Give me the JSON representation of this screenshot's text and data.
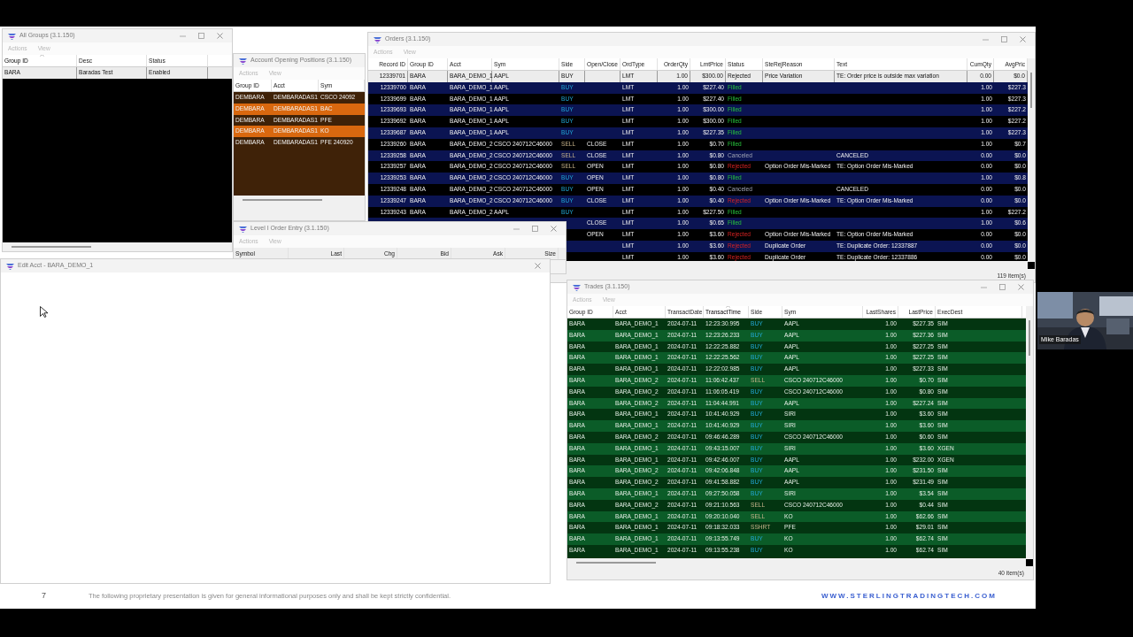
{
  "all_groups": {
    "title": "All Groups (3.1.150)",
    "menu": [
      "Actions",
      "View"
    ],
    "columns": [
      {
        "label": "Group ID",
        "sorted": true
      },
      {
        "label": "Desc",
        "sorted": false
      },
      {
        "label": "Status",
        "sorted": false
      }
    ],
    "rows": [
      {
        "cells": [
          "BARA",
          "Baradas Test",
          "Enabled"
        ],
        "selected": true
      }
    ]
  },
  "account_opening_positions": {
    "title": "Account Opening Positions (3.1.150)",
    "menu": [
      "Actions",
      "View"
    ],
    "columns": [
      {
        "label": "Group ID",
        "sorted": false
      },
      {
        "label": "Acct",
        "sorted": false
      },
      {
        "label": "Sym",
        "sorted": false
      }
    ],
    "rows": [
      {
        "cells": [
          "DEMBARA",
          "DEMBARADAS1",
          "CSCO 24092"
        ],
        "highlighted": false
      },
      {
        "cells": [
          "DEMBARA",
          "DEMBARADAS1",
          "BAC"
        ],
        "highlighted": true
      },
      {
        "cells": [
          "DEMBARA",
          "DEMBARADAS1",
          "PFE"
        ],
        "highlighted": false
      },
      {
        "cells": [
          "DEMBARA",
          "DEMBARADAS1",
          "KO"
        ],
        "highlighted": true
      },
      {
        "cells": [
          "DEMBARA",
          "DEMBARADAS1",
          "PFE 240920"
        ],
        "highlighted": false
      }
    ]
  },
  "orders": {
    "title": "Orders (3.1.150)",
    "menu": [
      "Actions",
      "View"
    ],
    "columns": [
      {
        "label": "Record ID",
        "sorted": false
      },
      {
        "label": "Group ID",
        "sorted": false
      },
      {
        "label": "Acct",
        "sorted": false
      },
      {
        "label": "Sym",
        "sorted": false
      },
      {
        "label": "Side",
        "sorted": false
      },
      {
        "label": "Open/Close",
        "sorted": false
      },
      {
        "label": "OrdType",
        "sorted": false
      },
      {
        "label": "OrderQty",
        "sorted": false
      },
      {
        "label": "LmtPrice",
        "sorted": false
      },
      {
        "label": "Status",
        "sorted": false
      },
      {
        "label": "SteRejReason",
        "sorted": false
      },
      {
        "label": "Text",
        "sorted": false
      },
      {
        "label": "CumQty",
        "sorted": false
      },
      {
        "label": "AvgPric",
        "sorted": false
      }
    ],
    "rows": [
      {
        "cells": [
          "12339701",
          "BARA",
          "BARA_DEMO_1",
          "AAPL",
          {
            "text": "BUY",
            "kind": "buy"
          },
          null,
          "LMT",
          "1.00",
          "$300.00",
          {
            "text": "Rejected",
            "kind": "rejected"
          },
          "Price Variation",
          "TE: Order price is outside max variation",
          "0.00",
          "$0.0"
        ],
        "selected": true
      },
      {
        "cells": [
          "12339700",
          "BARA",
          "BARA_DEMO_1",
          "AAPL",
          {
            "text": "BUY",
            "kind": "buy"
          },
          null,
          "LMT",
          "1.00",
          "$227.40",
          {
            "text": "Filled",
            "kind": "filled"
          },
          null,
          null,
          "1.00",
          "$227.3"
        ],
        "selected": false
      },
      {
        "cells": [
          "12339699",
          "BARA",
          "BARA_DEMO_1",
          "AAPL",
          {
            "text": "BUY",
            "kind": "buy"
          },
          null,
          "LMT",
          "1.00",
          "$227.40",
          {
            "text": "Filled",
            "kind": "filled"
          },
          null,
          null,
          "1.00",
          "$227.3"
        ],
        "selected": false
      },
      {
        "cells": [
          "12339693",
          "BARA",
          "BARA_DEMO_1",
          "AAPL",
          {
            "text": "BUY",
            "kind": "buy"
          },
          null,
          "LMT",
          "1.00",
          "$300.00",
          {
            "text": "Filled",
            "kind": "filled"
          },
          null,
          null,
          "1.00",
          "$227.2"
        ],
        "selected": false
      },
      {
        "cells": [
          "12339692",
          "BARA",
          "BARA_DEMO_1",
          "AAPL",
          {
            "text": "BUY",
            "kind": "buy"
          },
          null,
          "LMT",
          "1.00",
          "$300.00",
          {
            "text": "Filled",
            "kind": "filled"
          },
          null,
          null,
          "1.00",
          "$227.2"
        ],
        "selected": false
      },
      {
        "cells": [
          "12339687",
          "BARA",
          "BARA_DEMO_1",
          "AAPL",
          {
            "text": "BUY",
            "kind": "buy"
          },
          null,
          "LMT",
          "1.00",
          "$227.35",
          {
            "text": "Filled",
            "kind": "filled"
          },
          null,
          null,
          "1.00",
          "$227.3"
        ],
        "selected": false
      },
      {
        "cells": [
          "12339260",
          "BARA",
          "BARA_DEMO_2",
          "CSCO 240712C46000",
          {
            "text": "SELL",
            "kind": "sell"
          },
          "CLOSE",
          "LMT",
          "1.00",
          "$0.70",
          {
            "text": "Filled",
            "kind": "filled"
          },
          null,
          null,
          "1.00",
          "$0.7"
        ],
        "selected": false
      },
      {
        "cells": [
          "12339258",
          "BARA",
          "BARA_DEMO_2",
          "CSCO 240712C46000",
          {
            "text": "SELL",
            "kind": "sell"
          },
          "CLOSE",
          "LMT",
          "1.00",
          "$0.80",
          {
            "text": "Canceled",
            "kind": "canceled"
          },
          null,
          "CANCELED",
          "0.00",
          "$0.0"
        ],
        "selected": false
      },
      {
        "cells": [
          "12339257",
          "BARA",
          "BARA_DEMO_2",
          "CSCO 240712C46000",
          {
            "text": "SELL",
            "kind": "sell"
          },
          "OPEN",
          "LMT",
          "1.00",
          "$0.80",
          {
            "text": "Rejected",
            "kind": "rejected"
          },
          "Option Order Mis-Marked",
          "TE: Option Order Mis-Marked",
          "0.00",
          "$0.0"
        ],
        "selected": false
      },
      {
        "cells": [
          "12339253",
          "BARA",
          "BARA_DEMO_2",
          "CSCO 240712C46000",
          {
            "text": "BUY",
            "kind": "buy"
          },
          "OPEN",
          "LMT",
          "1.00",
          "$0.80",
          {
            "text": "Filled",
            "kind": "filled"
          },
          null,
          null,
          "1.00",
          "$0.8"
        ],
        "selected": false
      },
      {
        "cells": [
          "12339248",
          "BARA",
          "BARA_DEMO_2",
          "CSCO 240712C46000",
          {
            "text": "BUY",
            "kind": "buy"
          },
          "OPEN",
          "LMT",
          "1.00",
          "$0.40",
          {
            "text": "Canceled",
            "kind": "canceled"
          },
          null,
          "CANCELED",
          "0.00",
          "$0.0"
        ],
        "selected": false
      },
      {
        "cells": [
          "12339247",
          "BARA",
          "BARA_DEMO_2",
          "CSCO 240712C46000",
          {
            "text": "BUY",
            "kind": "buy"
          },
          "CLOSE",
          "LMT",
          "1.00",
          "$0.40",
          {
            "text": "Rejected",
            "kind": "rejected"
          },
          "Option Order Mis-Marked",
          "TE: Option Order Mis-Marked",
          "0.00",
          "$0.0"
        ],
        "selected": false
      },
      {
        "cells": [
          "12339243",
          "BARA",
          "BARA_DEMO_2",
          "AAPL",
          {
            "text": "BUY",
            "kind": "buy"
          },
          null,
          "LMT",
          "1.00",
          "$227.50",
          {
            "text": "Filled",
            "kind": "filled"
          },
          null,
          null,
          "1.00",
          "$227.2"
        ],
        "selected": false
      },
      {
        "cells": [
          null,
          null,
          null,
          null,
          null,
          "CLOSE",
          "LMT",
          "1.00",
          "$0.65",
          {
            "text": "Filled",
            "kind": "filled"
          },
          null,
          null,
          "1.00",
          "$0.6"
        ],
        "selected": false
      },
      {
        "cells": [
          null,
          null,
          null,
          null,
          null,
          "OPEN",
          "LMT",
          "1.00",
          "$3.60",
          {
            "text": "Rejected",
            "kind": "rejected"
          },
          "Option Order Mis-Marked",
          "TE: Option Order Mis-Marked",
          "0.00",
          "$0.0"
        ],
        "selected": false
      },
      {
        "cells": [
          null,
          null,
          null,
          null,
          null,
          null,
          "LMT",
          "1.00",
          "$3.60",
          {
            "text": "Rejected",
            "kind": "rejected"
          },
          "Duplicate Order",
          "TE: Duplicate Order: 12337887",
          "0.00",
          "$0.0"
        ],
        "selected": false
      },
      {
        "cells": [
          null,
          null,
          null,
          null,
          null,
          null,
          "LMT",
          "1.00",
          "$3.60",
          {
            "text": "Rejected",
            "kind": "rejected"
          },
          "Duplicate Order",
          "TE: Duplicate Order: 12337886",
          "0.00",
          "$0.0"
        ],
        "selected": false
      }
    ],
    "status_text": "119 item(s)"
  },
  "level_1_order_entry": {
    "title": "Level I Order Entry (3.1.150)",
    "menu": [
      "Actions",
      "View"
    ],
    "columns": [
      {
        "label": "Symbol",
        "sorted": false
      },
      {
        "label": "Last",
        "sorted": false
      },
      {
        "label": "Chg",
        "sorted": false
      },
      {
        "label": "Bid",
        "sorted": false
      },
      {
        "label": "Ask",
        "sorted": false
      },
      {
        "label": "Size",
        "sorted": false
      }
    ]
  },
  "edit_acct": {
    "title": "Edit Acct - BARA_DEMO_1"
  },
  "trades": {
    "title": "Trades (3.1.150)",
    "menu": [
      "Actions",
      "View"
    ],
    "columns": [
      {
        "label": "Group ID",
        "sorted": false
      },
      {
        "label": "Acct",
        "sorted": false
      },
      {
        "label": "TransactDate",
        "sorted": false
      },
      {
        "label": "TransactTime",
        "sorted": true
      },
      {
        "label": "Side",
        "sorted": false
      },
      {
        "label": "Sym",
        "sorted": false
      },
      {
        "label": "LastShares",
        "sorted": false
      },
      {
        "label": "LastPrice",
        "sorted": false
      },
      {
        "label": "ExecDest",
        "sorted": false
      }
    ],
    "rows": [
      {
        "cells": [
          "BARA",
          "BARA_DEMO_1",
          "2024-07-11",
          "12:23:30.995",
          {
            "text": "BUY",
            "kind": "buy"
          },
          "AAPL",
          "1.00",
          "$227.35",
          "SIM"
        ],
        "selected": false
      },
      {
        "cells": [
          "BARA",
          "BARA_DEMO_1",
          "2024-07-11",
          "12:23:26.233",
          {
            "text": "BUY",
            "kind": "buy"
          },
          "AAPL",
          "1.00",
          "$227.36",
          "SIM"
        ],
        "selected": false
      },
      {
        "cells": [
          "BARA",
          "BARA_DEMO_1",
          "2024-07-11",
          "12:22:25.882",
          {
            "text": "BUY",
            "kind": "buy"
          },
          "AAPL",
          "1.00",
          "$227.25",
          "SIM"
        ],
        "selected": false
      },
      {
        "cells": [
          "BARA",
          "BARA_DEMO_1",
          "2024-07-11",
          "12:22:25.562",
          {
            "text": "BUY",
            "kind": "buy"
          },
          "AAPL",
          "1.00",
          "$227.25",
          "SIM"
        ],
        "selected": false
      },
      {
        "cells": [
          "BARA",
          "BARA_DEMO_1",
          "2024-07-11",
          "12:22:02.985",
          {
            "text": "BUY",
            "kind": "buy"
          },
          "AAPL",
          "1.00",
          "$227.33",
          "SIM"
        ],
        "selected": false
      },
      {
        "cells": [
          "BARA",
          "BARA_DEMO_2",
          "2024-07-11",
          "11:06:42.437",
          {
            "text": "SELL",
            "kind": "sell"
          },
          "CSCO 240712C46000",
          "1.00",
          "$0.70",
          "SIM"
        ],
        "selected": false
      },
      {
        "cells": [
          "BARA",
          "BARA_DEMO_2",
          "2024-07-11",
          "11:06:05.419",
          {
            "text": "BUY",
            "kind": "buy"
          },
          "CSCO 240712C46000",
          "1.00",
          "$0.80",
          "SIM"
        ],
        "selected": false
      },
      {
        "cells": [
          "BARA",
          "BARA_DEMO_2",
          "2024-07-11",
          "11:04:44.991",
          {
            "text": "BUY",
            "kind": "buy"
          },
          "AAPL",
          "1.00",
          "$227.24",
          "SIM"
        ],
        "selected": false
      },
      {
        "cells": [
          "BARA",
          "BARA_DEMO_1",
          "2024-07-11",
          "10:41:40.929",
          {
            "text": "BUY",
            "kind": "buy"
          },
          "SIRI",
          "1.00",
          "$3.60",
          "SIM"
        ],
        "selected": false
      },
      {
        "cells": [
          "BARA",
          "BARA_DEMO_1",
          "2024-07-11",
          "10:41:40.929",
          {
            "text": "BUY",
            "kind": "buy"
          },
          "SIRI",
          "1.00",
          "$3.60",
          "SIM"
        ],
        "selected": false
      },
      {
        "cells": [
          "BARA",
          "BARA_DEMO_2",
          "2024-07-11",
          "09:46:46.289",
          {
            "text": "BUY",
            "kind": "buy"
          },
          "CSCO 240712C46000",
          "1.00",
          "$0.60",
          "SIM"
        ],
        "selected": false
      },
      {
        "cells": [
          "BARA",
          "BARA_DEMO_1",
          "2024-07-11",
          "09:43:15.007",
          {
            "text": "BUY",
            "kind": "buy"
          },
          "SIRI",
          "1.00",
          "$3.60",
          "XGEN"
        ],
        "selected": false
      },
      {
        "cells": [
          "BARA",
          "BARA_DEMO_1",
          "2024-07-11",
          "09:42:46.007",
          {
            "text": "BUY",
            "kind": "buy"
          },
          "AAPL",
          "1.00",
          "$232.00",
          "XGEN"
        ],
        "selected": false
      },
      {
        "cells": [
          "BARA",
          "BARA_DEMO_2",
          "2024-07-11",
          "09:42:06.848",
          {
            "text": "BUY",
            "kind": "buy"
          },
          "AAPL",
          "1.00",
          "$231.50",
          "SIM"
        ],
        "selected": false
      },
      {
        "cells": [
          "BARA",
          "BARA_DEMO_2",
          "2024-07-11",
          "09:41:58.882",
          {
            "text": "BUY",
            "kind": "buy"
          },
          "AAPL",
          "1.00",
          "$231.49",
          "SIM"
        ],
        "selected": false
      },
      {
        "cells": [
          "BARA",
          "BARA_DEMO_1",
          "2024-07-11",
          "09:27:50.058",
          {
            "text": "BUY",
            "kind": "buy"
          },
          "SIRI",
          "1.00",
          "$3.54",
          "SIM"
        ],
        "selected": false
      },
      {
        "cells": [
          "BARA",
          "BARA_DEMO_2",
          "2024-07-11",
          "09:21:10.563",
          {
            "text": "SELL",
            "kind": "sell"
          },
          "CSCO 240712C46000",
          "1.00",
          "$0.44",
          "SIM"
        ],
        "selected": false
      },
      {
        "cells": [
          "BARA",
          "BARA_DEMO_1",
          "2024-07-11",
          "09:20:10.040",
          {
            "text": "SELL",
            "kind": "sell"
          },
          "KO",
          "1.00",
          "$62.66",
          "SIM"
        ],
        "selected": false
      },
      {
        "cells": [
          "BARA",
          "BARA_DEMO_1",
          "2024-07-11",
          "09:18:32.033",
          {
            "text": "SSHRT",
            "kind": "sell"
          },
          "PFE",
          "1.00",
          "$29.01",
          "SIM"
        ],
        "selected": false
      },
      {
        "cells": [
          "BARA",
          "BARA_DEMO_1",
          "2024-07-11",
          "09:13:55.749",
          {
            "text": "BUY",
            "kind": "buy"
          },
          "KO",
          "1.00",
          "$62.74",
          "SIM"
        ],
        "selected": false
      },
      {
        "cells": [
          "BARA",
          "BARA_DEMO_1",
          "2024-07-11",
          "09:13:55.238",
          {
            "text": "BUY",
            "kind": "buy"
          },
          "KO",
          "1.00",
          "$62.74",
          "SIM"
        ],
        "selected": false
      }
    ],
    "status_text": "40 item(s)"
  },
  "webcam": {
    "name": "Mike Baradas"
  },
  "footer": {
    "page_number": "7",
    "disclaimer": "The following proprietary presentation is given for general informational purposes only and shall be kept strictly confidential.",
    "website": "WWW.STERLINGTRADINGTECH.COM"
  }
}
